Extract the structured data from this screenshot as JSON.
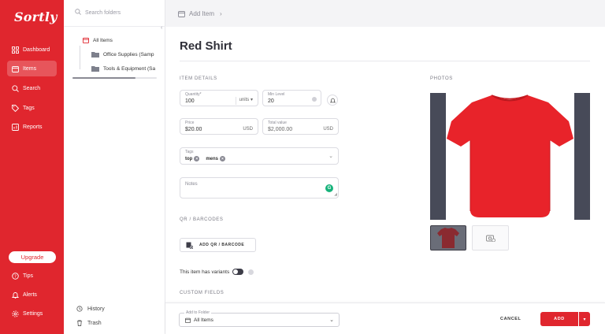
{
  "app": {
    "logo": "Sortly",
    "brand_color": "#e0262e"
  },
  "nav": {
    "items": [
      {
        "label": "Dashboard",
        "icon": "dashboard-icon"
      },
      {
        "label": "Items",
        "icon": "items-icon",
        "active": true
      },
      {
        "label": "Search",
        "icon": "search-icon"
      },
      {
        "label": "Tags",
        "icon": "tag-icon"
      },
      {
        "label": "Reports",
        "icon": "reports-icon"
      }
    ],
    "upgrade_label": "Upgrade",
    "bottom_items": [
      {
        "label": "Tips",
        "icon": "tips-icon"
      },
      {
        "label": "Alerts",
        "icon": "bell-icon"
      },
      {
        "label": "Settings",
        "icon": "gear-icon"
      }
    ]
  },
  "folders": {
    "search_placeholder": "Search folders",
    "root": "All Items",
    "children": [
      "Office Supplies (Samp",
      "Tools & Equipment (Sa"
    ],
    "history_label": "History",
    "trash_label": "Trash"
  },
  "header": {
    "breadcrumb": "Add Item"
  },
  "item": {
    "name": "Red Shirt",
    "details_title": "ITEM DETAILS",
    "quantity": {
      "label": "Quantity*",
      "value": "100",
      "unit": "units"
    },
    "min_level": {
      "label": "Min Level",
      "value": "20"
    },
    "price": {
      "label": "Price",
      "value": "$20.00",
      "unit": "USD"
    },
    "total_value": {
      "label": "Total value",
      "value": "$2,000.00",
      "unit": "USD"
    },
    "tags": {
      "label": "Tags",
      "values": [
        "top",
        "mens"
      ]
    },
    "notes": {
      "label": "Notes"
    },
    "qr_title": "QR / BARCODES",
    "barcode_button": "ADD QR / BARCODE",
    "variants_label": "This item has variants",
    "custom_fields_title": "CUSTOM FIELDS",
    "photos_title": "PHOTOS",
    "shirt_color": "#e8232a"
  },
  "footer": {
    "folder_label": "Add to Folder",
    "folder_value": "All Items",
    "cancel_label": "CANCEL",
    "add_label": "ADD"
  }
}
